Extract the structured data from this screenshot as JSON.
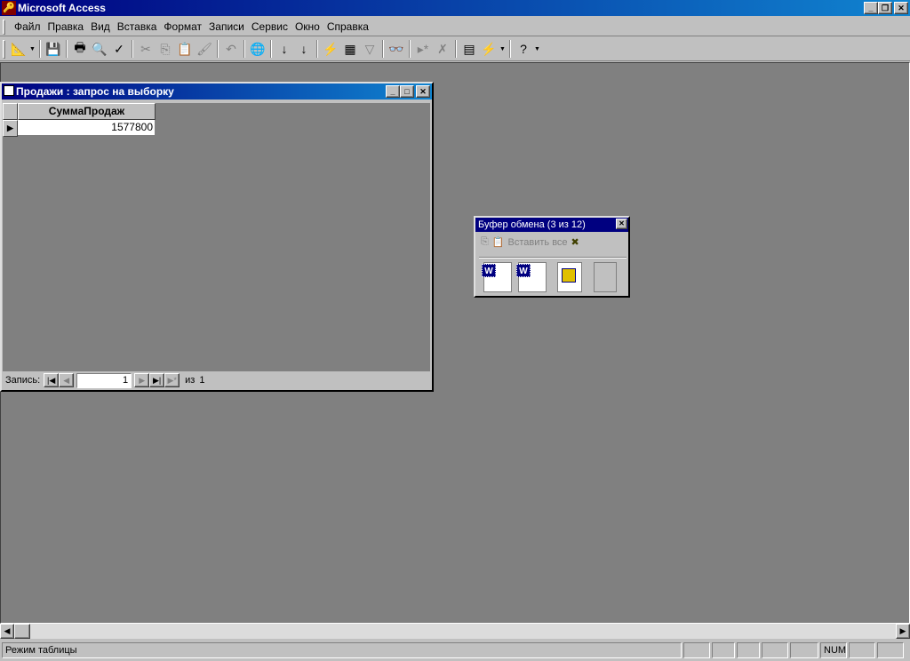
{
  "app": {
    "title": "Microsoft Access"
  },
  "menu": [
    "Файл",
    "Правка",
    "Вид",
    "Вставка",
    "Формат",
    "Записи",
    "Сервис",
    "Окно",
    "Справка"
  ],
  "toolbar": [
    {
      "icon": "design-view-icon",
      "glyph": "📐",
      "dd": true
    },
    {
      "sep": true
    },
    {
      "icon": "save-icon",
      "glyph": "💾"
    },
    {
      "sep": true
    },
    {
      "icon": "print-icon",
      "glyph": "🖶"
    },
    {
      "icon": "print-preview-icon",
      "glyph": "🔍"
    },
    {
      "icon": "spelling-icon",
      "glyph": "✓"
    },
    {
      "sep": true
    },
    {
      "icon": "cut-icon",
      "glyph": "✂",
      "dis": true
    },
    {
      "icon": "copy-icon",
      "glyph": "⎘",
      "dis": true
    },
    {
      "icon": "paste-icon",
      "glyph": "📋",
      "dis": true
    },
    {
      "icon": "format-painter-icon",
      "glyph": "🖌",
      "dis": true
    },
    {
      "sep": true
    },
    {
      "icon": "undo-icon",
      "glyph": "↶",
      "dis": true
    },
    {
      "sep": true
    },
    {
      "icon": "hyperlink-icon",
      "glyph": "🌐",
      "dis": true
    },
    {
      "sep": true
    },
    {
      "icon": "sort-ascending-icon",
      "glyph": "↓"
    },
    {
      "icon": "sort-descending-icon",
      "glyph": "↓"
    },
    {
      "sep": true
    },
    {
      "icon": "filter-by-selection-icon",
      "glyph": "⚡"
    },
    {
      "icon": "filter-by-form-icon",
      "glyph": "▦"
    },
    {
      "icon": "apply-filter-icon",
      "glyph": "▽",
      "dis": true
    },
    {
      "sep": true
    },
    {
      "icon": "find-icon",
      "glyph": "👓"
    },
    {
      "sep": true
    },
    {
      "icon": "new-record-icon",
      "glyph": "▸*",
      "dis": true
    },
    {
      "icon": "delete-record-icon",
      "glyph": "✗",
      "dis": true
    },
    {
      "sep": true
    },
    {
      "icon": "database-window-icon",
      "glyph": "▤"
    },
    {
      "icon": "new-object-icon",
      "glyph": "⚡",
      "dd": true
    },
    {
      "sep": true
    },
    {
      "icon": "help-icon",
      "glyph": "?",
      "dd": true
    }
  ],
  "query_window": {
    "title": "Продажи : запрос на выборку",
    "column": "СуммаПродаж",
    "value": "1577800",
    "nav": {
      "label": "Запись:",
      "current": "1",
      "of": "из",
      "total": "1"
    }
  },
  "clipboard": {
    "title": "Буфер обмена (3 из 12)",
    "paste_all": "Вставить все",
    "items": [
      "word-document",
      "word-document",
      "access-object",
      "empty"
    ]
  },
  "status": {
    "mode": "Режим таблицы",
    "num": "NUM"
  }
}
